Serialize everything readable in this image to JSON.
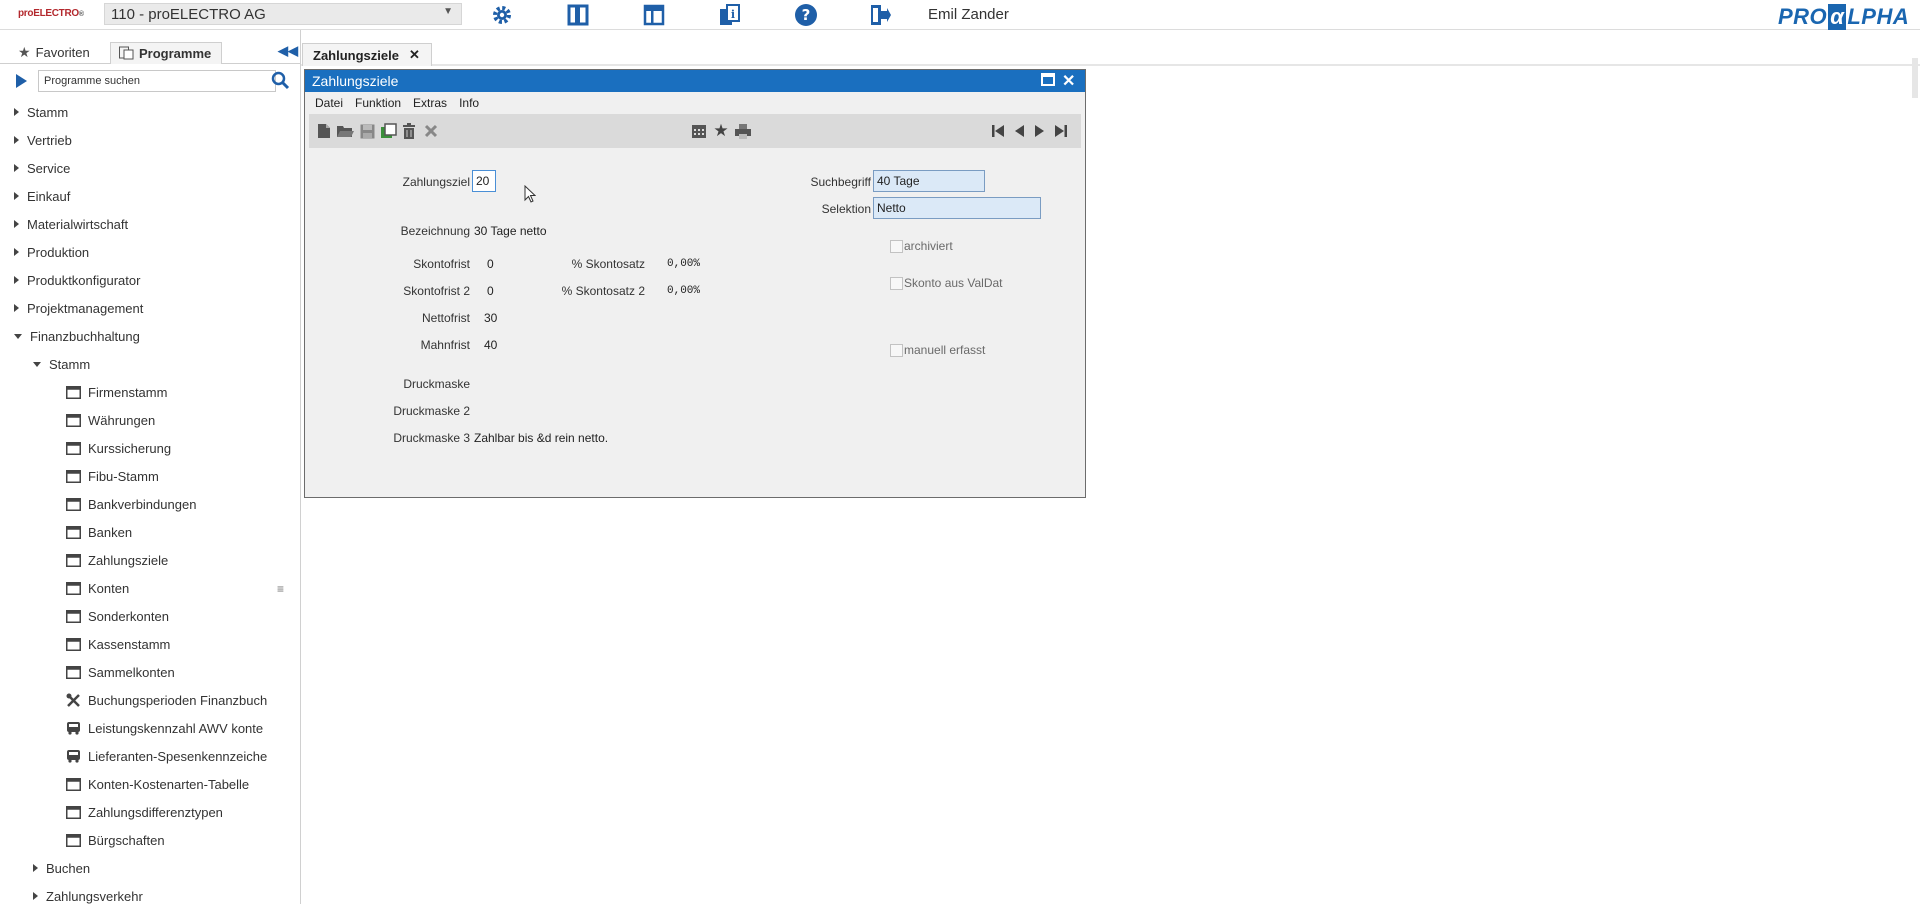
{
  "topbar": {
    "logo_text": "proELECTRO",
    "company": "110 - proELECTRO AG",
    "icons": [
      "gear-icon",
      "panel-single-icon",
      "panel-layout-icon",
      "info-document-icon",
      "help-icon",
      "logout-icon"
    ],
    "user": "Emil Zander",
    "brand": "PROALPHA"
  },
  "sidebar": {
    "tabs": {
      "favoriten": "Favoriten",
      "programme": "Programme"
    },
    "search_placeholder": "Programme suchen",
    "tree": [
      {
        "label": "Stamm",
        "level": 0,
        "arrow": "right"
      },
      {
        "label": "Vertrieb",
        "level": 0,
        "arrow": "right"
      },
      {
        "label": "Service",
        "level": 0,
        "arrow": "right"
      },
      {
        "label": "Einkauf",
        "level": 0,
        "arrow": "right"
      },
      {
        "label": "Materialwirtschaft",
        "level": 0,
        "arrow": "right"
      },
      {
        "label": "Produktion",
        "level": 0,
        "arrow": "right"
      },
      {
        "label": "Produktkonfigurator",
        "level": 0,
        "arrow": "right"
      },
      {
        "label": "Projektmanagement",
        "level": 0,
        "arrow": "right"
      },
      {
        "label": "Finanzbuchhaltung",
        "level": 0,
        "arrow": "down"
      },
      {
        "label": "Stamm",
        "level": 1,
        "arrow": "down"
      },
      {
        "label": "Firmenstamm",
        "level": 2,
        "icon": "window-icon"
      },
      {
        "label": "Währungen",
        "level": 2,
        "icon": "window-icon"
      },
      {
        "label": "Kurssicherung",
        "level": 2,
        "icon": "window-icon"
      },
      {
        "label": "Fibu-Stamm",
        "level": 2,
        "icon": "window-icon"
      },
      {
        "label": "Bankverbindungen",
        "level": 2,
        "icon": "window-icon"
      },
      {
        "label": "Banken",
        "level": 2,
        "icon": "window-icon"
      },
      {
        "label": "Zahlungsziele",
        "level": 2,
        "icon": "window-icon"
      },
      {
        "label": "Konten",
        "level": 2,
        "icon": "window-icon"
      },
      {
        "label": "Sonderkonten",
        "level": 2,
        "icon": "window-icon"
      },
      {
        "label": "Kassenstamm",
        "level": 2,
        "icon": "window-icon"
      },
      {
        "label": "Sammelkonten",
        "level": 2,
        "icon": "window-icon"
      },
      {
        "label": "Buchungsperioden Finanzbuch",
        "level": 2,
        "icon": "tools-icon"
      },
      {
        "label": "Leistungskennzahl AWV konte",
        "level": 2,
        "icon": "bus-icon"
      },
      {
        "label": "Lieferanten-Spesenkennzeiche",
        "level": 2,
        "icon": "bus-icon"
      },
      {
        "label": "Konten-Kostenarten-Tabelle",
        "level": 2,
        "icon": "window-icon"
      },
      {
        "label": "Zahlungsdifferenztypen",
        "level": 2,
        "icon": "window-icon"
      },
      {
        "label": "Bürgschaften",
        "level": 2,
        "icon": "window-icon"
      },
      {
        "label": "Buchen",
        "level": 1,
        "arrow": "right"
      },
      {
        "label": "Zahlungsverkehr",
        "level": 1,
        "arrow": "right"
      }
    ]
  },
  "main": {
    "tab_label": "Zahlungsziele",
    "window": {
      "title": "Zahlungsziele",
      "menu": [
        "Datei",
        "Funktion",
        "Extras",
        "Info"
      ],
      "form": {
        "zahlungsziel_label": "Zahlungsziel",
        "zahlungsziel_value": "20",
        "suchbegriff_label": "Suchbegriff",
        "suchbegriff_value": "40 Tage",
        "selektion_label": "Selektion",
        "selektion_value": "Netto",
        "bezeichnung_label": "Bezeichnung",
        "bezeichnung_value": "30 Tage netto",
        "archiviert_label": "archiviert",
        "skontofrist_label": "Skontofrist",
        "skontofrist_value": "0",
        "skontosatz_label": "% Skontosatz",
        "skontosatz_value": "0,00%",
        "skonto_valdat_label": "Skonto aus ValDat",
        "skontofrist2_label": "Skontofrist 2",
        "skontofrist2_value": "0",
        "skontosatz2_label": "% Skontosatz 2",
        "skontosatz2_value": "0,00%",
        "nettofrist_label": "Nettofrist",
        "nettofrist_value": "30",
        "mahnfrist_label": "Mahnfrist",
        "mahnfrist_value": "40",
        "manuell_label": "manuell erfasst",
        "druckmaske_label": "Druckmaske",
        "druckmaske2_label": "Druckmaske 2",
        "druckmaske3_label": "Druckmaske 3",
        "druckmaske3_value": "Zahlbar bis &d rein netto."
      }
    }
  }
}
